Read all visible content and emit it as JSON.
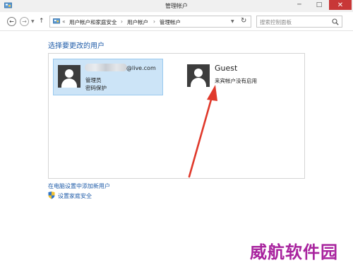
{
  "window": {
    "title": "管理帐户"
  },
  "titlebar": {
    "min_glyph": "─",
    "max_glyph": "□",
    "close_glyph": "✕"
  },
  "nav": {
    "back_glyph": "←",
    "forward_glyph": "→",
    "dropdown_glyph": "▼",
    "up_glyph": "↑"
  },
  "breadcrumb": {
    "overflow": "«",
    "items": [
      "用户帐户和家庭安全",
      "用户帐户",
      "管理帐户"
    ],
    "separator": "›",
    "dropdown_glyph": "▼",
    "refresh_glyph": "↻"
  },
  "search": {
    "placeholder": "搜索控制面板"
  },
  "main": {
    "heading": "选择要更改的用户"
  },
  "accounts": [
    {
      "name_suffix": "@live.com",
      "type": "管理员",
      "status": "密码保护",
      "selected": true
    },
    {
      "name": "Guest",
      "status": "来宾帐户没有启用",
      "selected": false
    }
  ],
  "links": {
    "add_user": "在电脑设置中添加新用户",
    "family_safety": "设置家庭安全"
  },
  "watermark": {
    "text": "威航软件园"
  },
  "colors": {
    "link": "#1e5ba8",
    "selection": "#cce4f7",
    "close": "#c83737",
    "arrow": "#e0392b",
    "watermark": "#a8239e"
  },
  "icons": [
    "control-panel-icon",
    "back-icon",
    "forward-icon",
    "up-icon",
    "refresh-icon",
    "search-icon",
    "user-avatar-icon",
    "shield-icon"
  ]
}
